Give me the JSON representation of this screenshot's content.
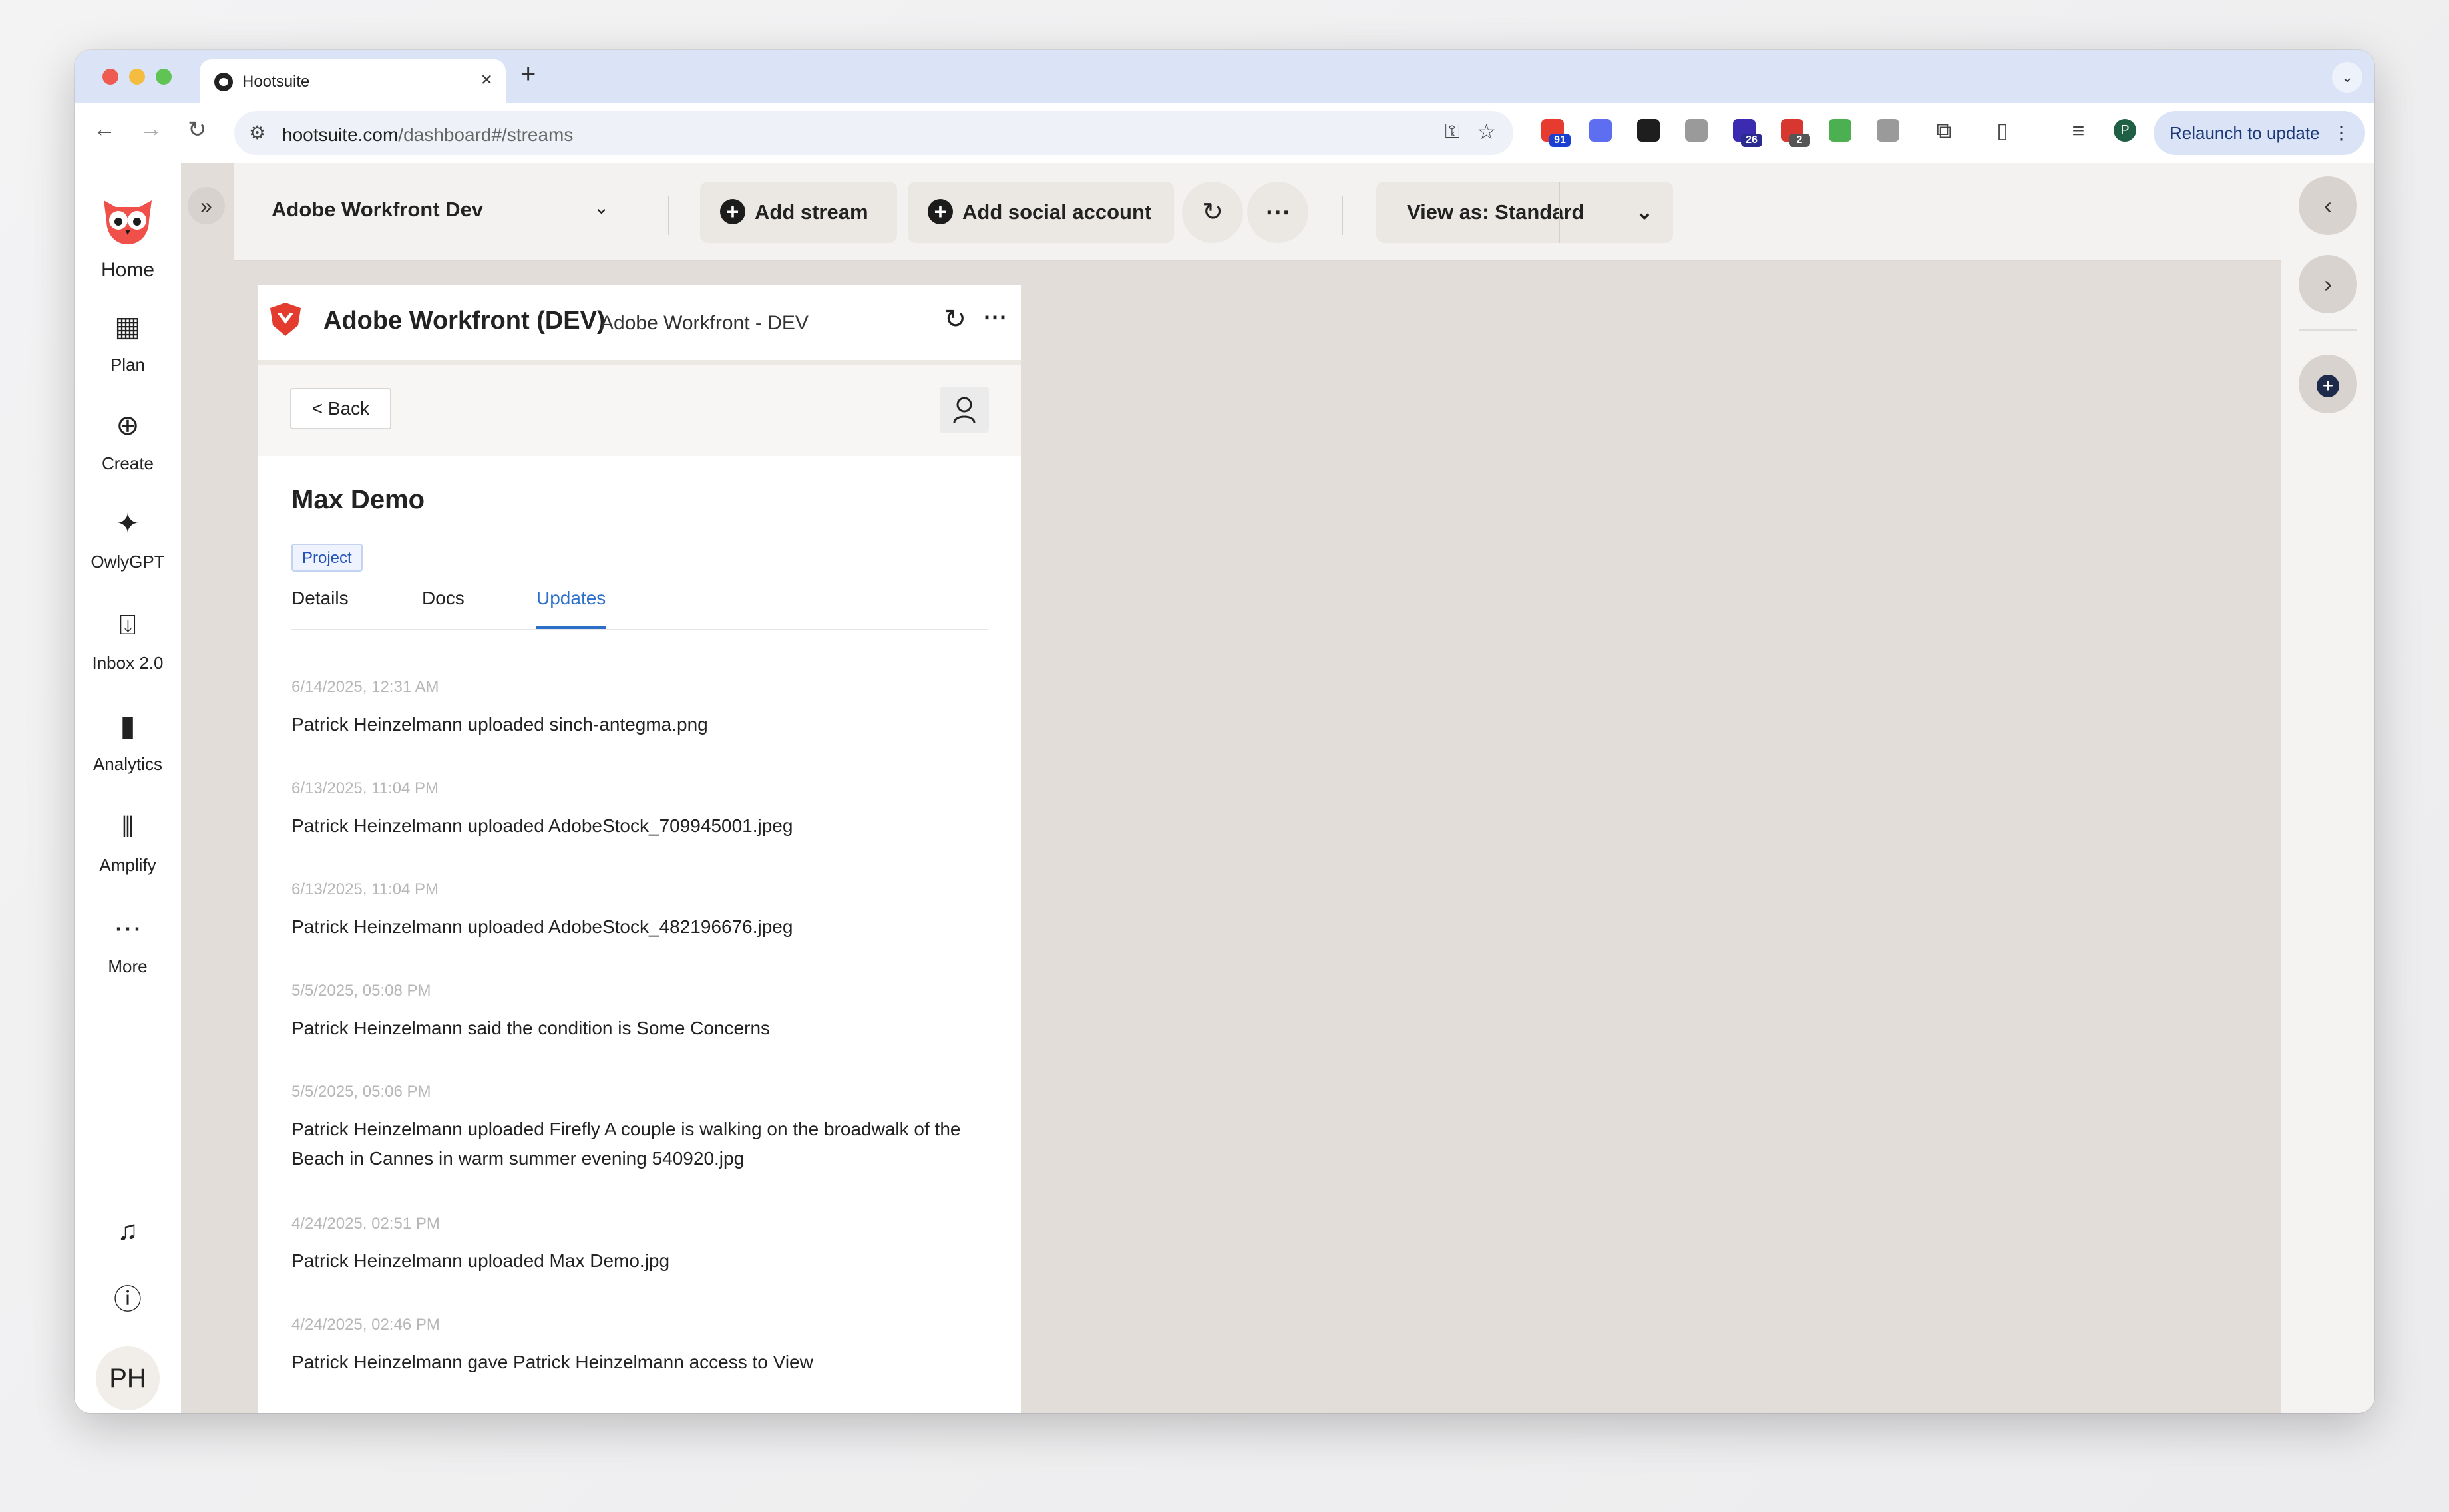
{
  "browser": {
    "tab_title": "Hootsuite",
    "url_host": "hootsuite.com",
    "url_path": "/dashboard#/streams",
    "relaunch_label": "Relaunch to update",
    "extensions": [
      {
        "name": "mail-extension-icon",
        "badge": "91",
        "color": "#e63b2e",
        "badge_color": "#1a3fd1"
      },
      {
        "name": "d-extension-icon",
        "badge": "",
        "color": "#5d6ef0"
      },
      {
        "name": "adobe-extension-icon",
        "badge": "",
        "color": "#1e1e1e"
      },
      {
        "name": "camera-extension-icon",
        "badge": "",
        "color": "#9a9a9a"
      },
      {
        "name": "grad-cap-extension-icon",
        "badge": "26",
        "color": "#3b2bb0",
        "badge_color": "#2b2b8f"
      },
      {
        "name": "calendar-extension-icon",
        "badge": "2",
        "color": "#d7372f",
        "badge_color": "#555555"
      },
      {
        "name": "colorwheel-extension-icon",
        "badge": "",
        "color": "#4caf50"
      },
      {
        "name": "a-extension-icon",
        "badge": "",
        "color": "#9a9a9a"
      }
    ],
    "profile_initial": "P"
  },
  "nav": {
    "items": [
      {
        "label": "Home",
        "icon": "owl-logo-icon"
      },
      {
        "label": "Plan",
        "icon": "calendar-icon"
      },
      {
        "label": "Create",
        "icon": "plus-circle-icon"
      },
      {
        "label": "OwlyGPT",
        "icon": "sparkle-icon"
      },
      {
        "label": "Inbox 2.0",
        "icon": "inbox-icon"
      },
      {
        "label": "Analytics",
        "icon": "bar-chart-icon"
      },
      {
        "label": "Amplify",
        "icon": "amplify-icon"
      },
      {
        "label": "More",
        "icon": "more-icon"
      }
    ],
    "avatar_initials": "PH"
  },
  "topbar": {
    "workspace": "Adobe Workfront Dev",
    "add_stream": "Add stream",
    "add_social": "Add social account",
    "view_as": "View as: Standard"
  },
  "stream": {
    "title": "Adobe Workfront (DEV)",
    "subtitle": "Adobe Workfront - DEV",
    "back_label": "< Back",
    "project_name": "Max Demo",
    "badge": "Project",
    "tabs": [
      {
        "label": "Details",
        "active": false
      },
      {
        "label": "Docs",
        "active": false
      },
      {
        "label": "Updates",
        "active": true
      }
    ],
    "updates": [
      {
        "time": "6/14/2025, 12:31 AM",
        "text": "Patrick Heinzelmann uploaded sinch-antegma.png"
      },
      {
        "time": "6/13/2025, 11:04 PM",
        "text": "Patrick Heinzelmann uploaded AdobeStock_709945001.jpeg"
      },
      {
        "time": "6/13/2025, 11:04 PM",
        "text": "Patrick Heinzelmann uploaded AdobeStock_482196676.jpeg"
      },
      {
        "time": "5/5/2025, 05:08 PM",
        "text": "Patrick Heinzelmann said the condition is Some Concerns"
      },
      {
        "time": "5/5/2025, 05:06 PM",
        "text": "Patrick Heinzelmann uploaded Firefly A couple is walking on the broadwalk of the Beach in Cannes in warm summer evening 540920.jpg"
      },
      {
        "time": "4/24/2025, 02:51 PM",
        "text": "Patrick Heinzelmann uploaded Max Demo.jpg"
      },
      {
        "time": "4/24/2025, 02:46 PM",
        "text": "Patrick Heinzelmann gave Patrick Heinzelmann access to View"
      }
    ]
  }
}
